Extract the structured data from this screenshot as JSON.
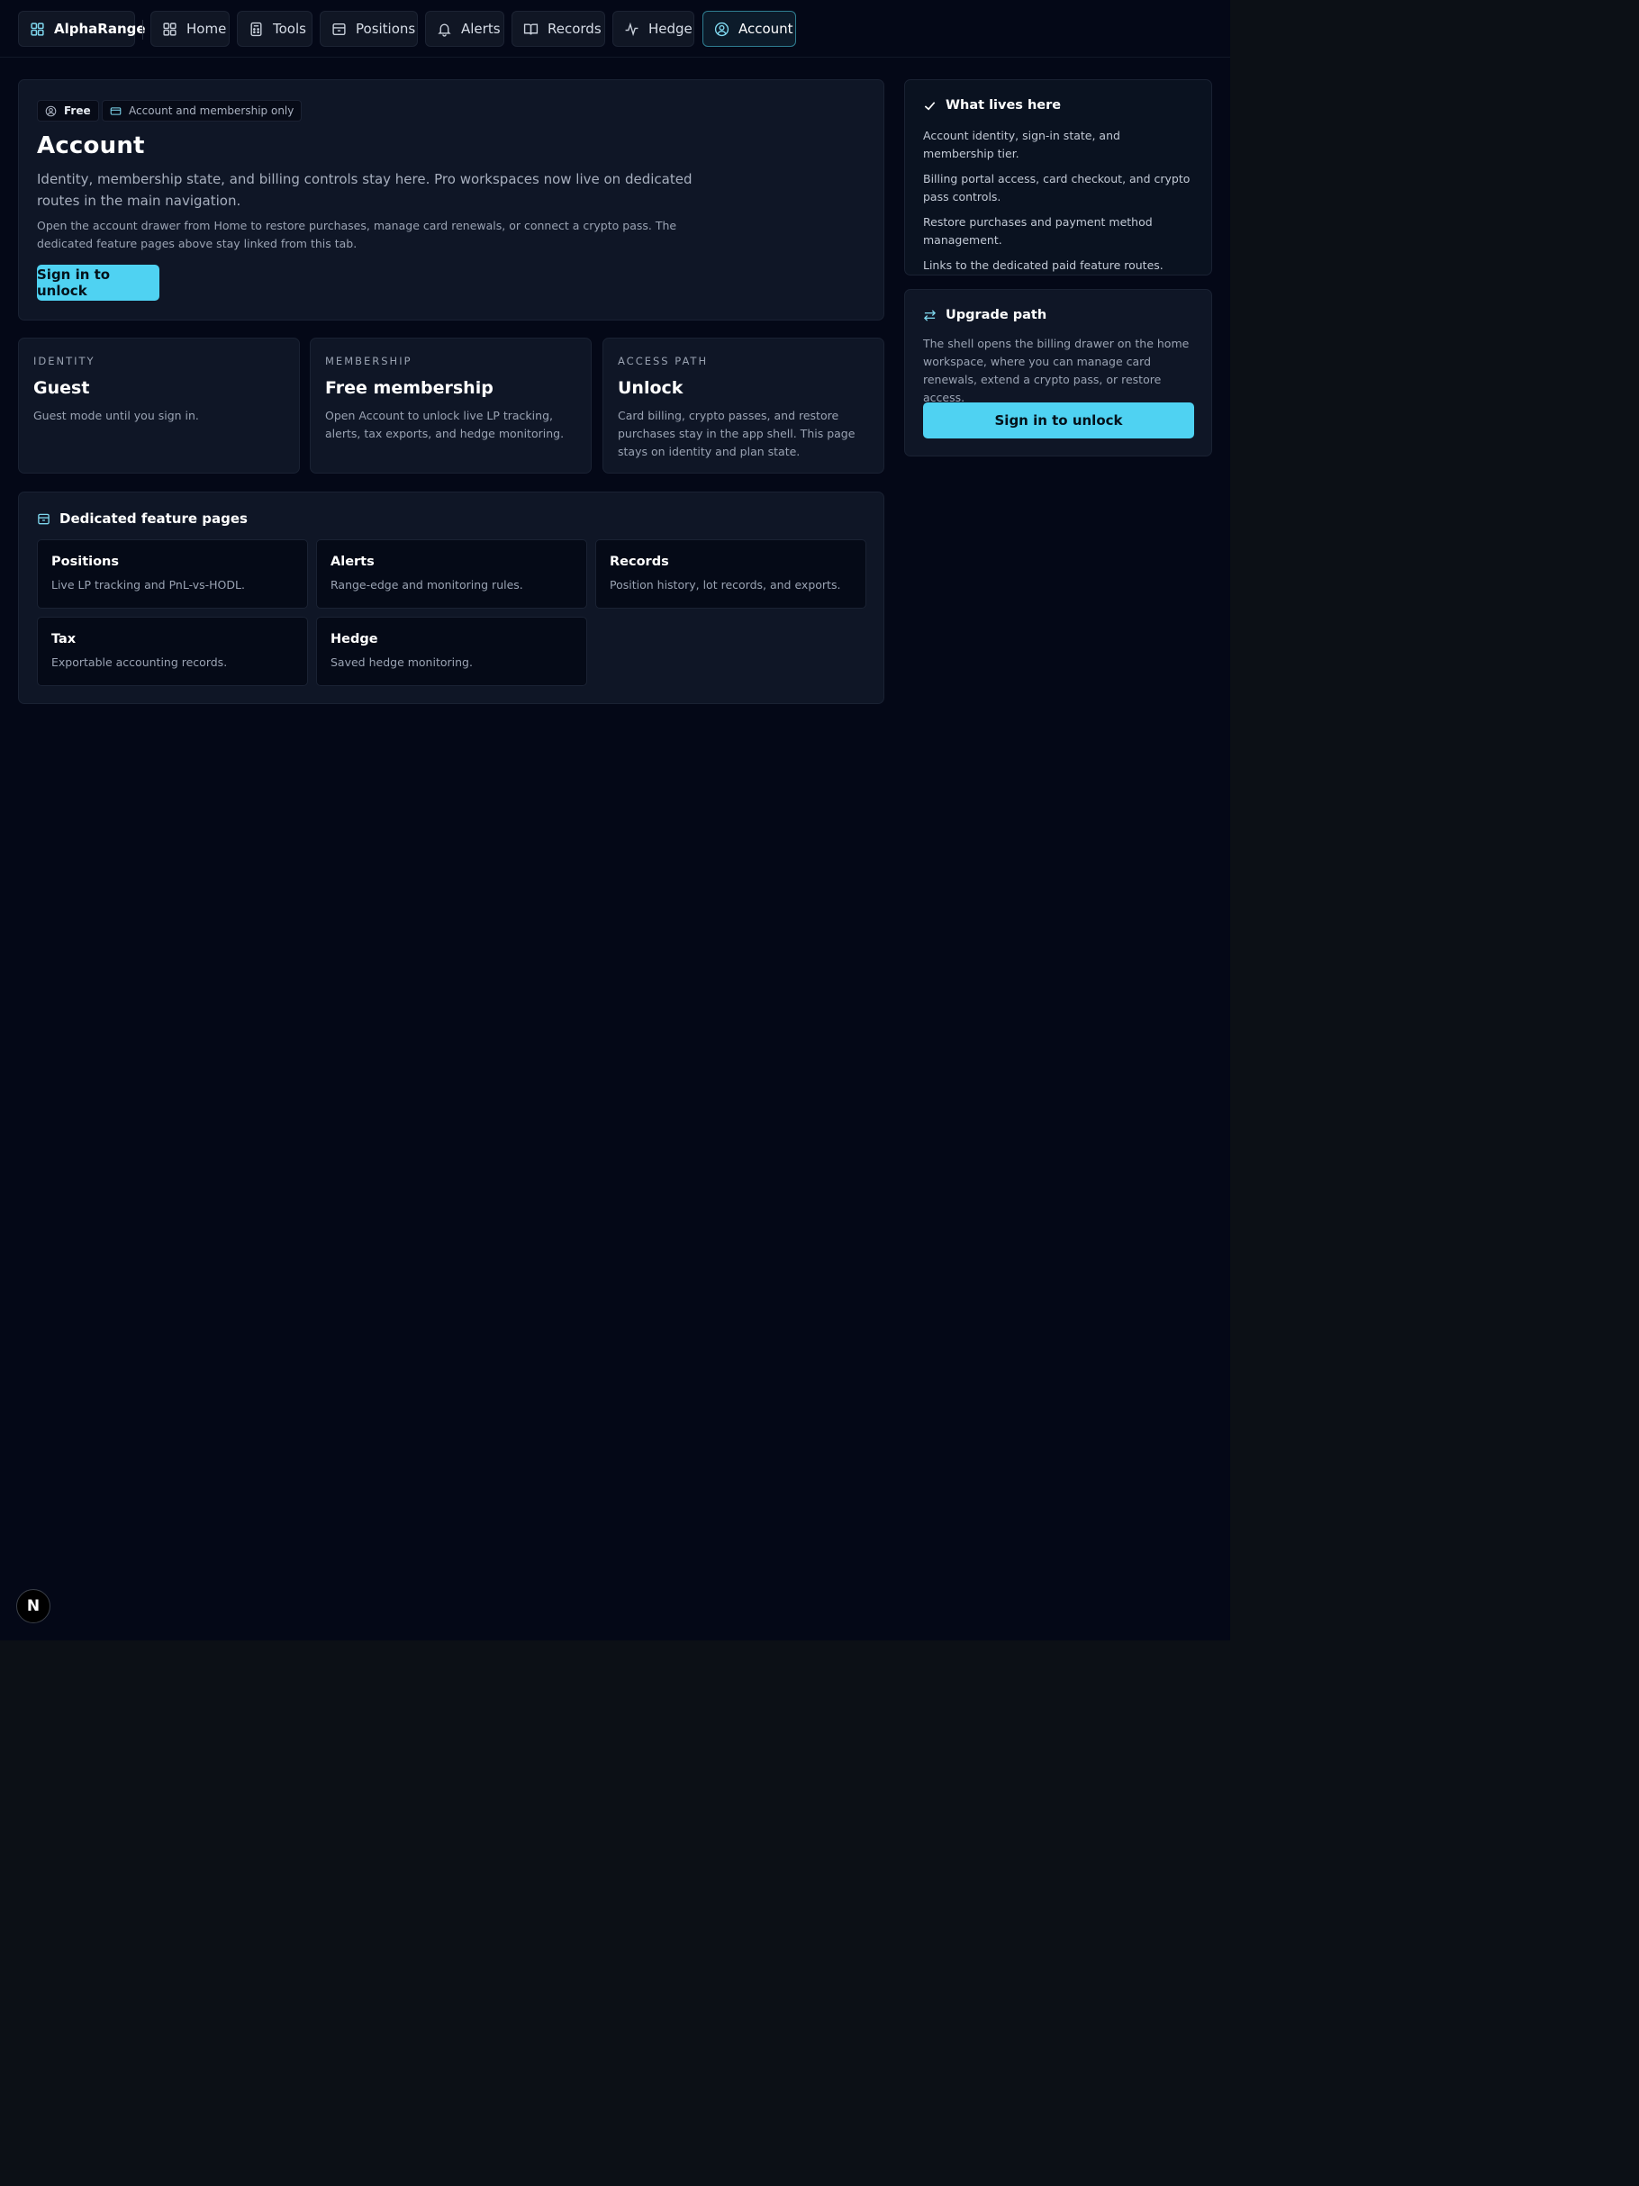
{
  "nav": {
    "brand": "AlphaRange",
    "items": [
      {
        "label": "Home"
      },
      {
        "label": "Tools"
      },
      {
        "label": "Positions"
      },
      {
        "label": "Alerts"
      },
      {
        "label": "Records"
      },
      {
        "label": "Hedge"
      },
      {
        "label": "Account"
      }
    ],
    "active": "Account"
  },
  "hero": {
    "chip_plan": "Free",
    "chip_scope": "Account and membership only",
    "title": "Account",
    "subtitle": "Identity, membership state, and billing controls stay here. Pro workspaces now live on dedicated routes in the main navigation.",
    "note": "Open the account drawer from Home to restore purchases, manage card renewals, or connect a crypto pass. The dedicated feature pages above stay linked from this tab.",
    "cta": "Sign in to unlock"
  },
  "stats": [
    {
      "label": "IDENTITY",
      "value": "Guest",
      "desc": "Guest mode until you sign in."
    },
    {
      "label": "MEMBERSHIP",
      "value": "Free membership",
      "desc": "Open Account to unlock live LP tracking, alerts, tax exports, and hedge monitoring."
    },
    {
      "label": "ACCESS PATH",
      "value": "Unlock",
      "desc": "Card billing, crypto passes, and restore purchases stay in the app shell. This page stays on identity and plan state."
    }
  ],
  "features": {
    "title": "Dedicated feature pages",
    "items": [
      {
        "title": "Positions",
        "desc": "Live LP tracking and PnL-vs-HODL."
      },
      {
        "title": "Alerts",
        "desc": "Range-edge and monitoring rules."
      },
      {
        "title": "Records",
        "desc": "Position history, lot records, and exports."
      },
      {
        "title": "Tax",
        "desc": "Exportable accounting records."
      },
      {
        "title": "Hedge",
        "desc": "Saved hedge monitoring."
      }
    ]
  },
  "sidebar": {
    "lives": {
      "title": "What lives here",
      "items": [
        "Account identity, sign-in state, and membership tier.",
        "Billing portal access, card checkout, and crypto pass controls.",
        "Restore purchases and payment method management.",
        "Links to the dedicated paid feature routes."
      ]
    },
    "upgrade": {
      "title": "Upgrade path",
      "desc": "The shell opens the billing drawer on the home workspace, where you can manage card renewals, extend a crypto pass, or restore access.",
      "cta": "Sign in to unlock"
    }
  },
  "badge": "N",
  "colors": {
    "accent": "#4fd2f2",
    "page_bg": "#040817",
    "card_bg": "#0f1626"
  }
}
